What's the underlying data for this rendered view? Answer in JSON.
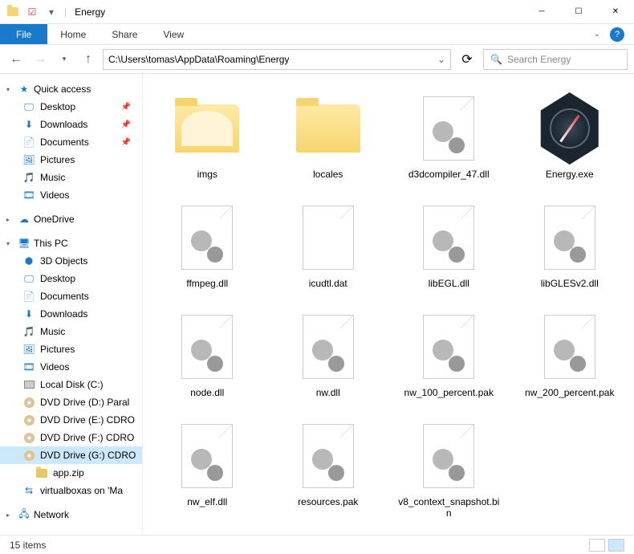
{
  "window": {
    "title": "Energy",
    "separator": "|"
  },
  "ribbon": {
    "file": "File",
    "tabs": [
      "Home",
      "Share",
      "View"
    ]
  },
  "nav": {
    "address": "C:\\Users\\tomas\\AppData\\Roaming\\Energy",
    "search_placeholder": "Search Energy"
  },
  "sidebar": {
    "quick_access": {
      "label": "Quick access",
      "items": [
        {
          "label": "Desktop",
          "pinned": true,
          "icon": "desktop"
        },
        {
          "label": "Downloads",
          "pinned": true,
          "icon": "downloads"
        },
        {
          "label": "Documents",
          "pinned": true,
          "icon": "documents"
        },
        {
          "label": "Pictures",
          "pinned": false,
          "icon": "pictures"
        },
        {
          "label": "Music",
          "pinned": false,
          "icon": "music"
        },
        {
          "label": "Videos",
          "pinned": false,
          "icon": "videos"
        }
      ]
    },
    "onedrive": {
      "label": "OneDrive"
    },
    "this_pc": {
      "label": "This PC",
      "items": [
        {
          "label": "3D Objects",
          "icon": "3d"
        },
        {
          "label": "Desktop",
          "icon": "desktop"
        },
        {
          "label": "Documents",
          "icon": "documents"
        },
        {
          "label": "Downloads",
          "icon": "downloads"
        },
        {
          "label": "Music",
          "icon": "music"
        },
        {
          "label": "Pictures",
          "icon": "pictures"
        },
        {
          "label": "Videos",
          "icon": "videos"
        },
        {
          "label": "Local Disk (C:)",
          "icon": "disk"
        },
        {
          "label": "DVD Drive (D:) Paral",
          "icon": "dvd"
        },
        {
          "label": "DVD Drive (E:) CDRO",
          "icon": "dvd"
        },
        {
          "label": "DVD Drive (F:) CDRO",
          "icon": "dvd"
        },
        {
          "label": "DVD Drive (G:) CDRO",
          "icon": "dvd",
          "selected": true,
          "child": "app.zip"
        },
        {
          "label": "virtualboxas on 'Ma",
          "icon": "netdrive"
        }
      ]
    },
    "network": {
      "label": "Network"
    }
  },
  "files": [
    {
      "name": "imgs",
      "type": "folder",
      "variant": "imgs"
    },
    {
      "name": "locales",
      "type": "folder"
    },
    {
      "name": "d3dcompiler_47.dll",
      "type": "dll"
    },
    {
      "name": "Energy.exe",
      "type": "exe"
    },
    {
      "name": "ffmpeg.dll",
      "type": "dll"
    },
    {
      "name": "icudtl.dat",
      "type": "dat"
    },
    {
      "name": "libEGL.dll",
      "type": "dll"
    },
    {
      "name": "libGLESv2.dll",
      "type": "dll"
    },
    {
      "name": "node.dll",
      "type": "dll"
    },
    {
      "name": "nw.dll",
      "type": "dll"
    },
    {
      "name": "nw_100_percent.pak",
      "type": "pak"
    },
    {
      "name": "nw_200_percent.pak",
      "type": "pak"
    },
    {
      "name": "nw_elf.dll",
      "type": "dll"
    },
    {
      "name": "resources.pak",
      "type": "pak"
    },
    {
      "name": "v8_context_snapshot.bin",
      "type": "bin"
    }
  ],
  "status": {
    "count": "15 items"
  }
}
